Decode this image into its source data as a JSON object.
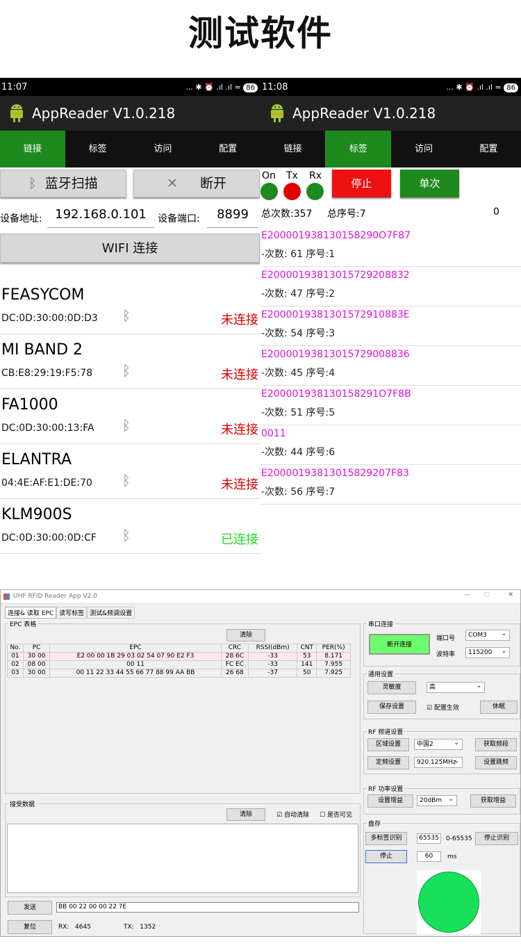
{
  "page_title": "测试软件",
  "app_title": "AppReader V1.0.218",
  "left_phone": {
    "status": {
      "time": "11:07",
      "icons": "... ✱ ⏰ .ıl .ıl ≈",
      "battery": "86"
    },
    "tabs": [
      {
        "label": "链接",
        "active": true
      },
      {
        "label": "标签",
        "active": false
      },
      {
        "label": "访问",
        "active": false
      },
      {
        "label": "配置",
        "active": false
      }
    ],
    "bt_scan_label": "蓝牙扫描",
    "disconnect_label": "断开",
    "addr_label": "设备地址:",
    "addr_value": "192.168.0.101",
    "port_label": "设备端口:",
    "port_value": "8899",
    "wifi_label": "WIFI 连接",
    "devices": [
      {
        "name": "FEASYCOM",
        "mac": "DC:0D:30:00:0D:D3",
        "status": "未连接",
        "color": "#e00000"
      },
      {
        "name": "MI BAND 2",
        "mac": "CB:E8:29:19:F5:78",
        "status": "未连接",
        "color": "#e00000"
      },
      {
        "name": "FA1000",
        "mac": "DC:0D:30:00:13:FA",
        "status": "未连接",
        "color": "#e00000"
      },
      {
        "name": "ELANTRA",
        "mac": "04:4E:AF:E1:DE:70",
        "status": "未连接",
        "color": "#e00000"
      },
      {
        "name": "KLM900S",
        "mac": "DC:0D:30:00:0D:CF",
        "status": "已连接",
        "color": "#22dd22"
      }
    ]
  },
  "right_phone": {
    "status": {
      "time": "11:08",
      "icons": "... ✱ ⏰ .ıl .ıl ≈",
      "battery": "86"
    },
    "tabs": [
      {
        "label": "链接",
        "active": false
      },
      {
        "label": "标签",
        "active": true
      },
      {
        "label": "访问",
        "active": false
      },
      {
        "label": "配置",
        "active": false
      }
    ],
    "ind_on": "On",
    "ind_tx": "Tx",
    "ind_rx": "Rx",
    "stop_label": "停止",
    "single_label": "单次",
    "total_count": "总次数:357",
    "total_seq": "总序号:7",
    "zero": "0",
    "records": [
      {
        "epc": "E200001938130158290O7F87",
        "count": "-次数: 61 序号:1"
      },
      {
        "epc": "E20000193813015729208832",
        "count": "-次数: 47 序号:2"
      },
      {
        "epc": "E2000019381301572910883E",
        "count": "-次数: 54 序号:3"
      },
      {
        "epc": "E20000193813015729008836",
        "count": "-次数: 45 序号:4"
      },
      {
        "epc": "E200001938130158291O7F8B",
        "count": "-次数: 51 序号:5"
      },
      {
        "epc": "0011",
        "count": "-次数: 44 序号:6"
      },
      {
        "epc": "E20000193813015829207F83",
        "count": "-次数: 56 序号:7"
      }
    ]
  },
  "pc": {
    "window_title": "UHF RFID Reader App V2.0",
    "tabs": [
      "连接& 读取 EPC",
      "读写标签",
      "测试&频调设置"
    ],
    "epc_group": "EPC 表格",
    "clear_label": "清除",
    "columns": [
      "No.",
      "PC",
      "EPC",
      "CRC",
      "RSSI(dBm)",
      "CNT",
      "PER(%)"
    ],
    "rows": [
      [
        "01",
        "30 00",
        "E2 00 00 1B 29 03 02 54 07 90 E2 F3",
        "28 6C",
        "-33",
        "53",
        "8.171"
      ],
      [
        "02",
        "08 00",
        "00 11",
        "FC EC",
        "-33",
        "141",
        "7.955"
      ],
      [
        "03",
        "30 00",
        "00 11 22 33 44 55 66 77 88 99 AA BB",
        "26 68",
        "-37",
        "50",
        "7.925"
      ]
    ],
    "recv_group": "接受数据",
    "recv_clear": "清除",
    "auto_clear": "自动清除",
    "visible_label": "是否可见",
    "send_label": "发送",
    "send_value": "BB 00 22 00 00 22 7E",
    "reset_label": "复位",
    "rx_label": "RX:",
    "rx_value": "4645",
    "tx_label": "TX:",
    "tx_value": "1352",
    "serial_group": "串口连接",
    "disconnect_btn": "断开连接",
    "port_label": "端口号",
    "port_value": "COM3",
    "baud_label": "波特率",
    "baud_value": "115200",
    "general_group": "通用设置",
    "sensitivity_btn": "灵敏度",
    "sensitivity_value": "高",
    "save_btn": "保存设置",
    "config_effect": "配置生效",
    "sleep_btn": "休眠",
    "rf_freq_group": "RF 频道设置",
    "region_btn": "区域设置",
    "region_value": "中国2",
    "get_hop_btn": "获取频段",
    "fixed_btn": "定频设置",
    "fixed_value": "920.125MHz",
    "set_hop_btn": "设置跳频",
    "rf_power_group": "RF 功率设置",
    "set_gain_btn": "设置增益",
    "gain_value": "20dBm",
    "get_gain_btn": "获取增益",
    "inventory_group": "盘存",
    "multi_btn": "多标签识别",
    "multi_value": "65535",
    "range_label": "0-65535",
    "stop_id_btn": "停止识别",
    "stop_btn": "停止",
    "ms_value": "60",
    "ms_label": "ms"
  }
}
